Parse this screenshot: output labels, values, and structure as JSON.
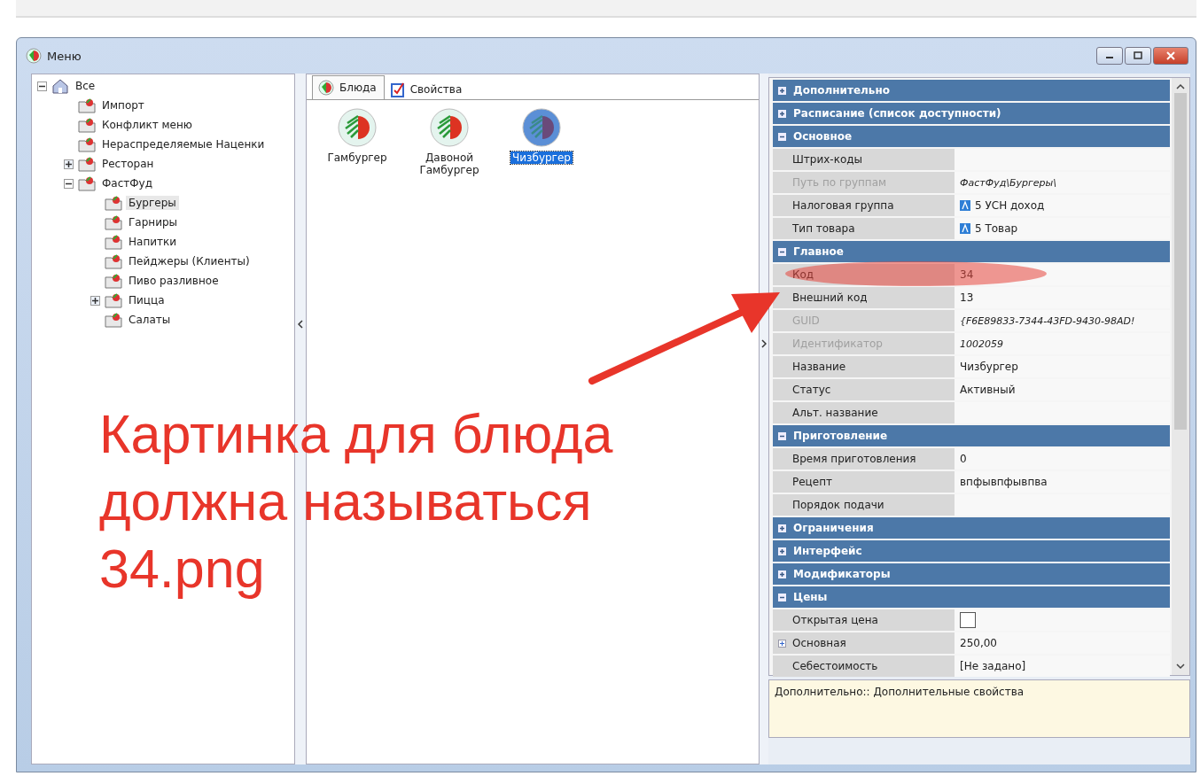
{
  "window": {
    "title": "Меню"
  },
  "tree": [
    {
      "label": "Все",
      "kind": "root",
      "expanded": true,
      "selected": false,
      "children": [
        {
          "label": "Импорт",
          "kind": "folder",
          "selected": false
        },
        {
          "label": "Конфликт меню",
          "kind": "folder",
          "selected": false
        },
        {
          "label": "Нераспределяемые Наценки",
          "kind": "folder",
          "selected": false
        },
        {
          "label": "Ресторан",
          "kind": "folder",
          "expanded": false,
          "selected": false
        },
        {
          "label": "ФастФуд",
          "kind": "folder",
          "expanded": true,
          "selected": false,
          "children": [
            {
              "label": "Бургеры",
              "kind": "folder",
              "selected": true
            },
            {
              "label": "Гарниры",
              "kind": "folder",
              "selected": false
            },
            {
              "label": "Напитки",
              "kind": "folder",
              "selected": false
            },
            {
              "label": "Пейджеры (Клиенты)",
              "kind": "folder",
              "selected": false
            },
            {
              "label": "Пиво разливное",
              "kind": "folder",
              "selected": false
            },
            {
              "label": "Пицца",
              "kind": "folder",
              "expanded": false,
              "selected": false
            },
            {
              "label": "Салаты",
              "kind": "folder",
              "selected": false
            }
          ]
        }
      ]
    }
  ],
  "tabs": [
    {
      "label": "Блюда",
      "kind": "dishes",
      "selected": true
    },
    {
      "label": "Свойства",
      "kind": "properties",
      "selected": false
    }
  ],
  "dishes": [
    {
      "name": "Гамбургер",
      "selected": false
    },
    {
      "name": "Давоной Гамбургер",
      "selected": false
    },
    {
      "name": "Чизбургер",
      "selected": true
    }
  ],
  "properties": [
    {
      "category": "Дополнительно",
      "expanded": false
    },
    {
      "category": "Расписание (список доступности)",
      "expanded": false
    },
    {
      "category": "Основное",
      "expanded": true,
      "rows": [
        {
          "label": "Штрих-коды",
          "kind": "text",
          "disabled": false
        },
        {
          "label": "Путь по группам",
          "value": "ФастФуд\\Бургеры\\",
          "kind": "text",
          "disabled": true
        },
        {
          "label": "Налоговая группа",
          "value": "5 УСН доход",
          "kind": "ref",
          "disabled": false
        },
        {
          "label": "Тип товара",
          "value": "5 Товар",
          "kind": "ref",
          "disabled": false
        }
      ]
    },
    {
      "category": "Главное",
      "expanded": true,
      "rows": [
        {
          "label": "Код",
          "value": "34",
          "kind": "text",
          "disabled": false,
          "highlighted": true
        },
        {
          "label": "Внешний код",
          "value": "13",
          "kind": "text",
          "disabled": false
        },
        {
          "label": "GUID",
          "value": "{F6E89833-7344-43FD-9430-98AD!",
          "kind": "text",
          "disabled": true
        },
        {
          "label": "Идентификатор",
          "value": "1002059",
          "kind": "text",
          "disabled": true
        },
        {
          "label": "Название",
          "value": "Чизбургер",
          "kind": "text",
          "disabled": false
        },
        {
          "label": "Статус",
          "value": "Активный",
          "kind": "text",
          "disabled": false
        },
        {
          "label": "Альт. название",
          "kind": "text",
          "disabled": false
        }
      ]
    },
    {
      "category": "Приготовление",
      "expanded": true,
      "rows": [
        {
          "label": "Время приготовления",
          "value": "0",
          "kind": "text",
          "disabled": false
        },
        {
          "label": "Рецепт",
          "value": "впфывпфывпва",
          "kind": "text",
          "disabled": false
        },
        {
          "label": "Порядок подачи",
          "kind": "text",
          "disabled": false
        }
      ]
    },
    {
      "category": "Ограничения",
      "expanded": false
    },
    {
      "category": "Интерфейс",
      "expanded": false
    },
    {
      "category": "Модификаторы",
      "expanded": false
    },
    {
      "category": "Цены",
      "expanded": true,
      "rows": [
        {
          "label": "Открытая цена",
          "kind": "check",
          "checked": false,
          "disabled": false
        },
        {
          "label": "Основная",
          "value": "250,00",
          "kind": "sub",
          "disabled": false
        },
        {
          "label": "Себестоимость",
          "value": "[Не задано]",
          "kind": "text",
          "disabled": false
        }
      ]
    }
  ],
  "description": "Дополнительно:: Дополнительные свойства",
  "annotation": {
    "text": "Картинка для блюда должна называться 34.png"
  }
}
